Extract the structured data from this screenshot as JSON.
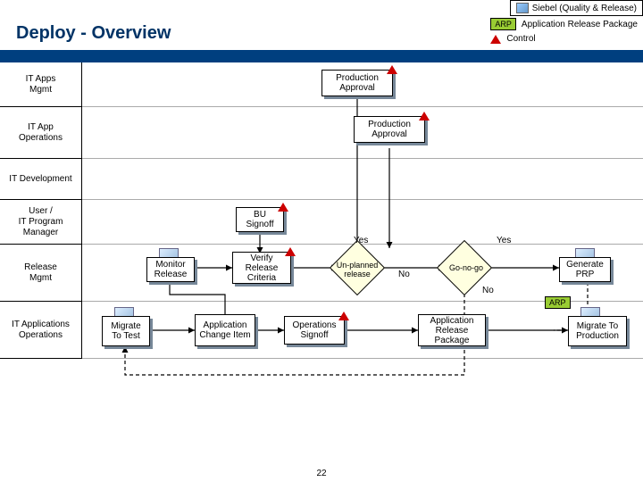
{
  "header": {
    "suite": "Siebel (Quality & Release)",
    "title": "Deploy - Overview"
  },
  "legend": {
    "arp_chip": "ARP",
    "arp_label": "Application Release Package",
    "control_label": "Control"
  },
  "lanes": [
    {
      "line1": "IT Apps",
      "line2": "Mgmt"
    },
    {
      "line1": "IT App",
      "line2": "Operations"
    },
    {
      "line1": "IT Development",
      "line2": ""
    },
    {
      "line1": "User /",
      "line2": "IT Program Manager"
    },
    {
      "line1": "Release",
      "line2": "Mgmt"
    },
    {
      "line1": "IT Applications",
      "line2": "Operations"
    }
  ],
  "nodes": {
    "prod_approval_1": "Production Approval",
    "prod_approval_2": "Production Approval",
    "bu_signoff": "BU Signoff",
    "monitor_release": "Monitor Release",
    "verify_release_criteria": "Verify Release Criteria",
    "generate_prp": "Generate PRP",
    "migrate_to_test": "Migrate To Test",
    "application_change_item": "Application Change Item",
    "operations_signoff": "Operations Signoff",
    "application_release_package": "Application Release Package",
    "migrate_to_production": "Migrate To Production"
  },
  "decisions": {
    "unplanned_release": "Un-planned release",
    "go_no_go": "Go-no-go"
  },
  "edge_labels": {
    "yes1": "Yes",
    "yes2": "Yes",
    "no1": "No",
    "no2": "No",
    "arp_edge": "ARP"
  },
  "page_number": "22"
}
